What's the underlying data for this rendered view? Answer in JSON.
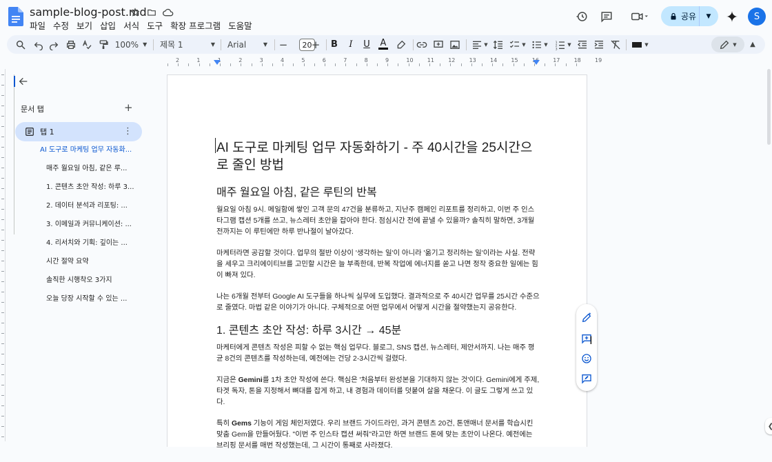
{
  "header": {
    "doc_title": "sample-blog-post.md",
    "menu": [
      "파일",
      "수정",
      "보기",
      "삽입",
      "서식",
      "도구",
      "확장 프로그램",
      "도움말"
    ],
    "share_label": "공유",
    "avatar_initial": "S"
  },
  "toolbar": {
    "zoom": "100%",
    "style": "제목 1",
    "font": "Arial",
    "font_size": "20",
    "minus": "−",
    "plus": "+"
  },
  "ruler": {
    "ticks": [
      "2",
      "1",
      "1",
      "2",
      "3",
      "4",
      "5",
      "6",
      "7",
      "8",
      "9",
      "10",
      "11",
      "12",
      "13",
      "14",
      "15",
      "16",
      "17",
      "18",
      "19"
    ]
  },
  "sidebar": {
    "tabs_title": "문서 탭",
    "add": "+",
    "tab_label": "탭 1",
    "outline": [
      {
        "level": "h1",
        "text": "AI 도구로 마케팅 업무 자동화..."
      },
      {
        "level": "h2",
        "text": "매주 월요일 아침, 같은 루..."
      },
      {
        "level": "h2",
        "text": "1. 콘텐츠 초안 작성: 하루 3..."
      },
      {
        "level": "h2",
        "text": "2. 데이터 분석과 리포팅: ..."
      },
      {
        "level": "h2",
        "text": "3. 이메일과 커뮤니케이션: ..."
      },
      {
        "level": "h2",
        "text": "4. 리서치와 기획: 깊이는 ..."
      },
      {
        "level": "h2",
        "text": "시간 절약 요약"
      },
      {
        "level": "h2",
        "text": "솔직한 시행착오 3가지"
      },
      {
        "level": "h2",
        "text": "오늘 당장 시작할 수 있는 ..."
      }
    ]
  },
  "document": {
    "title": "AI 도구로 마케팅 업무 자동화하기 - 주 40시간을 25시간으로 줄인 방법",
    "h2_1": "매주 월요일 아침, 같은 루틴의 반복",
    "p1": "월요일 아침 9시. 메일함에 쌓인 고객 문의 47건을 분류하고, 지난주 캠페인 리포트를 정리하고, 이번 주 인스타그램 캡션 5개를 쓰고, 뉴스레터 초안을 잡아야 한다. 점심시간 전에 끝낼 수 있을까? 솔직히 말하면, 3개월 전까지는 이 루틴에만 하루 반나절이 날아갔다.",
    "p2": "마케터라면 공감할 것이다. 업무의 절반 이상이 '생각하는 일'이 아니라 '옮기고 정리하는 일'이라는 사실. 전략을 세우고 크리에이티브를 고민할 시간은 늘 부족한데, 반복 작업에 에너지를 쏟고 나면 정작 중요한 일에는 힘이 빠져 있다.",
    "p3": "나는 6개월 전부터 Google AI 도구들을 하나씩 실무에 도입했다. 결과적으로 주 40시간 업무를 25시간 수준으로 줄였다. 마법 같은 이야기가 아니다. 구체적으로 어떤 업무에서 어떻게 시간을 절약했는지 공유한다.",
    "h2_2": "1. 콘텐츠 초안 작성: 하루 3시간 → 45분",
    "p4": "마케터에게 콘텐츠 작성은 피할 수 없는 핵심 업무다. 블로그, SNS 캡션, 뉴스레터, 제안서까지. 나는 매주 평균 8건의 콘텐츠를 작성하는데, 예전에는 건당 2-3시간씩 걸렸다.",
    "p5_pre": "지금은 ",
    "p5_bold": "Gemini",
    "p5_post": "를 1차 초안 작성에 쓴다. 핵심은 '처음부터 완성본을 기대하지 않는 것'이다. Gemini에게 주제, 타겟 독자, 톤을 지정해서 뼈대를 잡게 하고, 내 경험과 데이터를 덧붙여 살을 채운다. 이 글도 그렇게 쓰고 있다.",
    "p6_pre": "특히 ",
    "p6_bold": "Gems",
    "p6_post": " 기능이 게임 체인저였다. 우리 브랜드 가이드라인, 과거 콘텐츠 20건, 톤앤매너 문서를 학습시킨 맞춤 Gem을 만들어뒀다. \"이번 주 인스타 캡션 써줘\"라고만 하면 브랜드 톤에 맞는 초안이 나온다. 예전에는 브리핑 문서를 매번 작성했는데, 그 시간이 통째로 사라졌다."
  },
  "colors": {
    "accent": "#0b57d0",
    "share_bg": "#c2e7ff",
    "toolbar_bg": "#edf2fa",
    "tab_active_bg": "#d3e3fd"
  },
  "icons": [
    "docs-logo-icon",
    "star-icon",
    "folder-move-icon",
    "cloud-icon",
    "history-icon",
    "comment-icon",
    "video-icon",
    "lock-icon",
    "gemini-icon",
    "search-icon",
    "undo-icon",
    "redo-icon",
    "print-icon",
    "spellcheck-icon",
    "paint-format-icon",
    "bold-icon",
    "italic-icon",
    "underline-icon",
    "text-color-icon",
    "highlight-icon",
    "link-icon",
    "add-comment-icon",
    "image-icon",
    "align-icon",
    "line-spacing-icon",
    "checklist-icon",
    "bullet-list-icon",
    "numbered-list-icon",
    "indent-decrease-icon",
    "indent-increase-icon",
    "clear-format-icon",
    "editing-mode-icon",
    "collapse-icon",
    "back-arrow-icon",
    "tab-icon",
    "more-icon",
    "help-me-write-icon",
    "add-comment-float-icon",
    "emoji-icon",
    "suggest-edit-icon"
  ]
}
